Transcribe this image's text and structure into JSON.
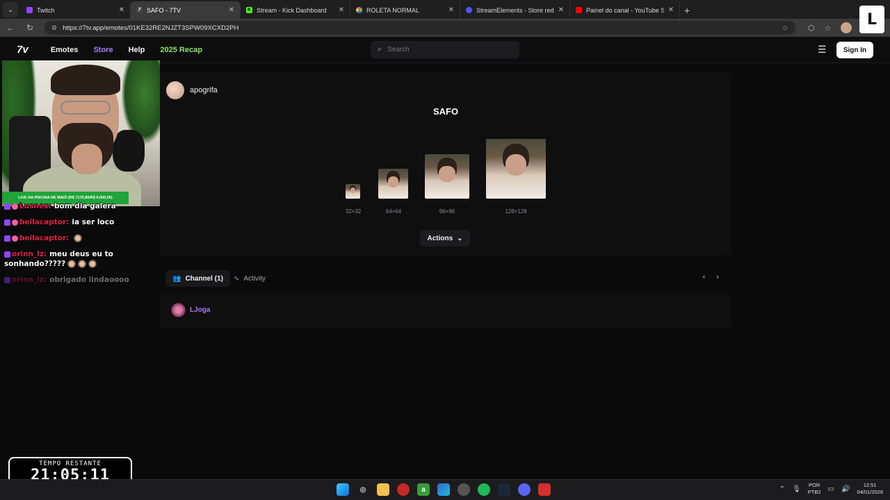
{
  "browser": {
    "tabs": [
      {
        "title": "Twitch",
        "icon": "twitch-icon",
        "color": "#9146ff",
        "active": false
      },
      {
        "title": "SAFO - 7TV",
        "icon": "7tv-icon",
        "color": "#ffffff",
        "active": true
      },
      {
        "title": "Stream - Kick Dashboard",
        "icon": "kick-icon",
        "color": "#53fc18",
        "active": false
      },
      {
        "title": "ROLETA NORMAL",
        "icon": "roulette-icon",
        "color": "#e84a4a",
        "active": false
      },
      {
        "title": "StreamElements - Store redemptio",
        "icon": "streamelements-icon",
        "color": "#4a55ff",
        "active": false
      },
      {
        "title": "Painel do canal - YouTube Studio",
        "icon": "youtube-icon",
        "color": "#ff0000",
        "active": false
      }
    ],
    "url": "https://7tv.app/emotes/01KE32RE2NJZT3SPW09XCXD2PH"
  },
  "site": {
    "logo": "7v",
    "nav": {
      "emotes": "Emotes",
      "store": "Store",
      "help": "Help",
      "recap": "2025 Recap"
    },
    "search_placeholder": "Search",
    "sign_in": "Sign In"
  },
  "emote": {
    "uploader": "apogrifa",
    "name": "SAFO",
    "sizes": [
      "32×32",
      "64×64",
      "96×96",
      "128×128"
    ],
    "actions_label": "Actions"
  },
  "tabs": {
    "channel": "Channel (1)",
    "activity": "Activity"
  },
  "channels": [
    {
      "name": "LJoga"
    }
  ],
  "overlay": {
    "live_banner": "LIVE NA PISCINA DE MAIÔ (R$ 7176,80/R$ 9.000,00)",
    "chat": [
      {
        "user": "Lusnex:",
        "text": "bom dia galera"
      },
      {
        "user": "bellacaptor:",
        "text": "ia ser loco"
      },
      {
        "user": "bellacaptor:",
        "text": ""
      },
      {
        "user": "orinn_lz:",
        "text": "meu deus eu to sonhando?????"
      },
      {
        "user": "orinn_lz:",
        "text": "obrigado lindaoooo"
      }
    ],
    "timer_label": "TEMPO RESTANTE",
    "timer_value": "21:05:11"
  },
  "taskbar": {
    "lang_line1": "POR",
    "lang_line2": "PTB2",
    "time": "12:51",
    "date": "04/01/2026"
  }
}
